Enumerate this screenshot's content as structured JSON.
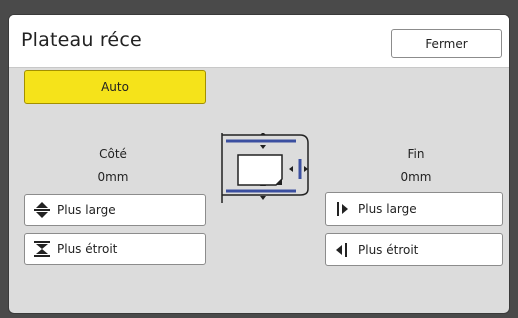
{
  "header": {
    "title": "Plateau réce",
    "close_label": "Fermer"
  },
  "auto_label": "Auto",
  "cote": {
    "label": "Côté",
    "value": "0mm",
    "wider_label": "Plus large",
    "narrower_label": "Plus étroit"
  },
  "fin": {
    "label": "Fin",
    "value": "0mm",
    "wider_label": "Plus large",
    "narrower_label": "Plus étroit"
  },
  "icons": {
    "cote_wider": "expand-vertical-icon",
    "cote_narrower": "collapse-vertical-icon",
    "fin_wider": "arrow-right-bar-icon",
    "fin_narrower": "arrow-left-bar-icon",
    "diagram": "paper-guide-diagram-icon"
  },
  "colors": {
    "auto_button": "#f5e31a",
    "guide_lines": "#3b4fa0",
    "background": "#dcdcdc"
  }
}
